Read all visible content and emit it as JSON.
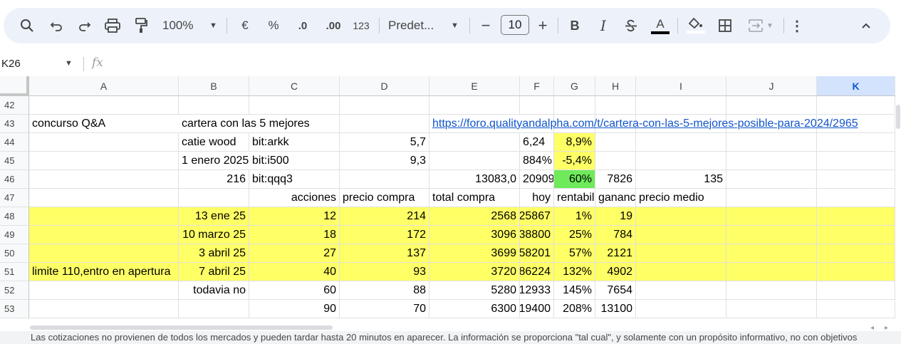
{
  "toolbar": {
    "zoom": "100%",
    "currency": "€",
    "percent": "%",
    "dec_less": ".0",
    "dec_more": ".00",
    "number_format": "123",
    "font": "Predet...",
    "font_size": "10",
    "minus": "−",
    "plus": "+",
    "bold": "B",
    "italic": "I",
    "text_color": "A",
    "more": "⋮",
    "collapse": "^"
  },
  "formula_bar": {
    "name_box": "K26",
    "fx": "fx"
  },
  "grid": {
    "columns": [
      "A",
      "B",
      "C",
      "D",
      "E",
      "F",
      "G",
      "H",
      "I",
      "J",
      "K"
    ],
    "selected_column": "K",
    "row_numbers": [
      "42",
      "43",
      "44",
      "45",
      "46",
      "47",
      "48",
      "49",
      "50",
      "51",
      "52",
      "53"
    ],
    "cells": {
      "A43": "concurso Q&A",
      "B43": "cartera con las 5 mejores",
      "E43": "https://foro.qualityandalpha.com/t/cartera-con-las-5-mejores-posible-para-2024/2965",
      "B44": "catie wood",
      "C44": "bit:arkk",
      "D44": "5,7",
      "F44": "6,24",
      "G44": "8,9%",
      "B45": "1 enero 2025",
      "C45": "bit:i500",
      "D45": "9,3",
      "F45": "884%",
      "G45": "-5,4%",
      "B46": "216",
      "C46": "bit:qqq3",
      "E46": "13083,0",
      "F46": "20909",
      "G46": "60%",
      "H46": "7826",
      "I46": "135",
      "C47": "acciones",
      "D47": "precio compra",
      "E47": "total compra",
      "F47": "hoy",
      "G47": "rentabilidad",
      "H47": "ganancia",
      "I47": "precio medio",
      "B48": "13 ene 25",
      "C48": "12",
      "D48": "214",
      "E48": "2568",
      "F48": "25867",
      "G48": "1%",
      "H48": "19",
      "B49": "10 marzo 25",
      "C49": "18",
      "D49": "172",
      "E49": "3096",
      "F49": "38800",
      "G49": "25%",
      "H49": "784",
      "B50": "3 abril 25",
      "C50": "27",
      "D50": "137",
      "E50": "3699",
      "F50": "58201",
      "G50": "57%",
      "H50": "2121",
      "A51": "limite 110,entro en apertura",
      "B51": "7 abril 25",
      "C51": "40",
      "D51": "93",
      "E51": "3720",
      "F51": "86224",
      "G51": "132%",
      "H51": "4902",
      "B52": "todavia no",
      "C52": "60",
      "D52": "88",
      "E52": "5280",
      "F52": "12933",
      "G52": "145%",
      "H52": "7654",
      "C53": "90",
      "D53": "70",
      "E53": "6300",
      "F53": "19400",
      "G53": "208%",
      "H53": "13100"
    }
  },
  "footer": {
    "disclaimer": "Las cotizaciones no provienen de todos los mercados y pueden tardar hasta 20 minutos en aparecer. La información se proporciona \"tal cual\", y solamente con un propósito informativo, no con objetivos"
  },
  "colors": {
    "highlight_yellow": "#ffff66",
    "highlight_green": "#6eea5a",
    "link_blue": "#1155cc",
    "selected_header": "#d3e3fd"
  }
}
